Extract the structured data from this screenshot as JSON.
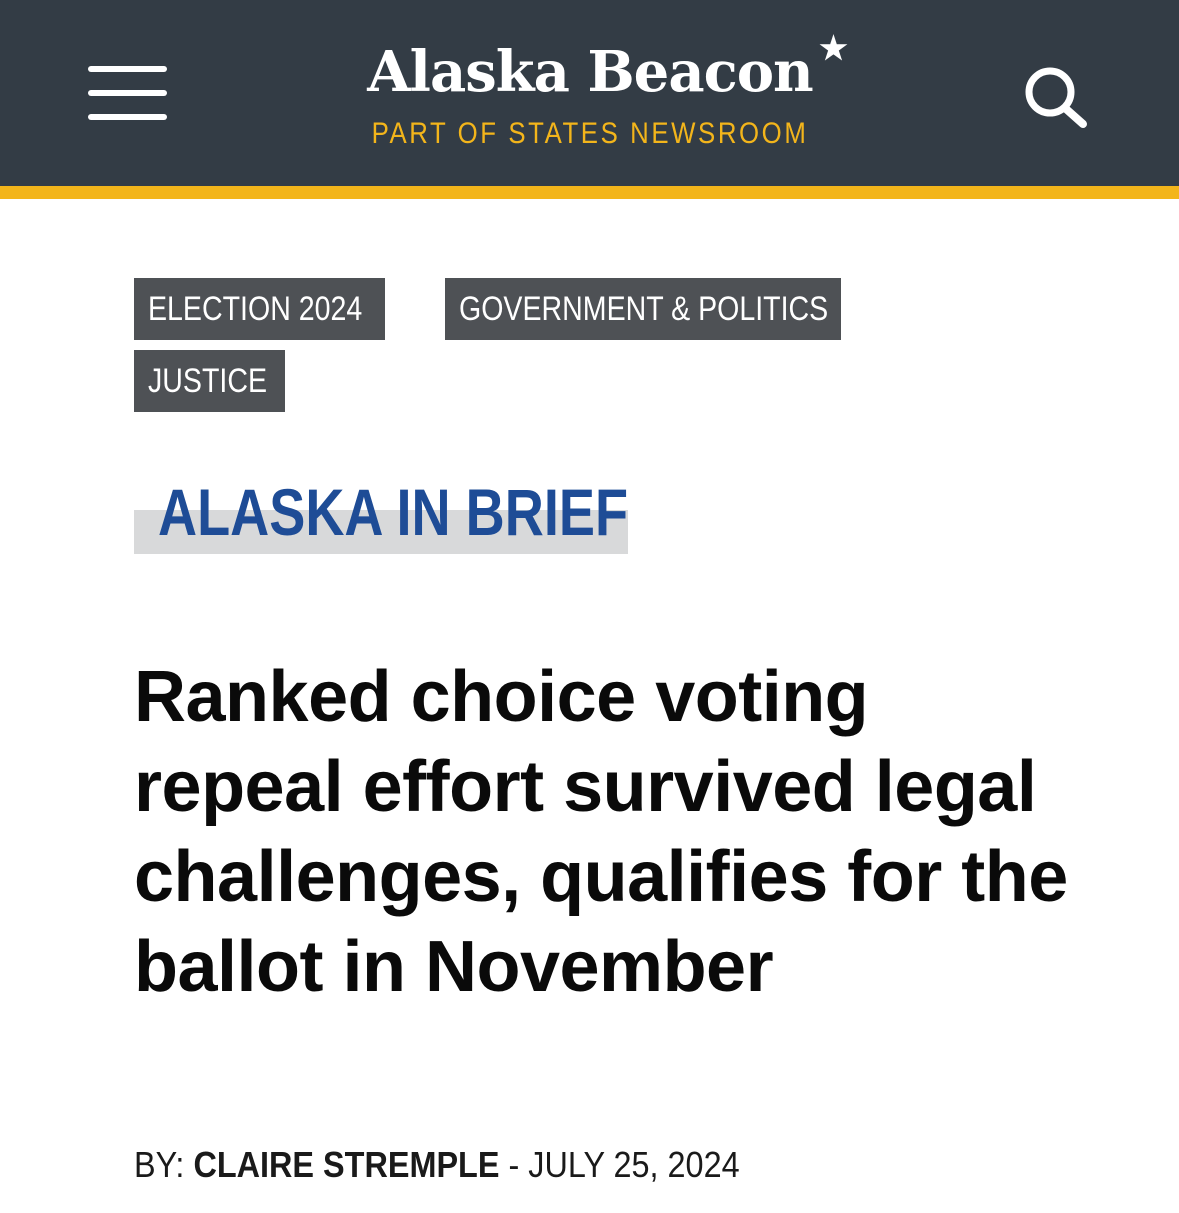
{
  "header": {
    "menu_icon": "hamburger-menu-icon",
    "brand_name": "Alaska Beacon",
    "brand_star": "★",
    "tagline": "PART OF STATES NEWSROOM",
    "search_icon": "search-icon",
    "colors": {
      "background": "#333c45",
      "accent": "#f3b51b"
    }
  },
  "tags": [
    {
      "label": "ELECTION 2024"
    },
    {
      "label": "GOVERNMENT & POLITICS"
    },
    {
      "label": "JUSTICE"
    }
  ],
  "kicker": {
    "label": "ALASKA IN BRIEF",
    "color": "#1e4c96"
  },
  "article": {
    "headline": "Ranked choice voting repeal effort survived legal challenges, qualifies for the ballot in November",
    "byline_prefix": "BY: ",
    "author": "CLAIRE STREMPLE",
    "separator": " - ",
    "date": "JULY 25, 2024"
  }
}
